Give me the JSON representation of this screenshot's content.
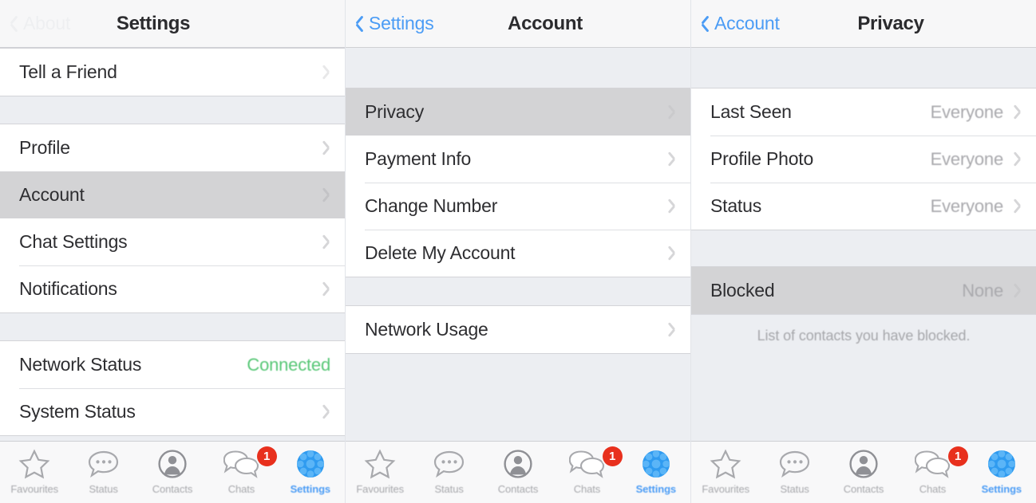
{
  "app": "WhatsApp iOS Settings",
  "colors": {
    "accent_blue": "#4b9cf5",
    "status_green": "#57c776",
    "badge_red": "#e8301d",
    "row_selected": "#d3d3d5",
    "page_background": "#eceef2",
    "row_background": "#ffffff"
  },
  "screens": [
    {
      "id": "settings",
      "nav": {
        "back_label": "About",
        "back_visible_faint": true,
        "title": "Settings"
      },
      "groups": [
        {
          "gap_before": 0,
          "rows": [
            {
              "label": "Tell a Friend",
              "value": "",
              "chevron": true,
              "selected": false
            }
          ]
        },
        {
          "gap_before": 34,
          "rows": [
            {
              "label": "Profile",
              "value": "",
              "chevron": true,
              "selected": false
            },
            {
              "label": "Account",
              "value": "",
              "chevron": true,
              "selected": true
            },
            {
              "label": "Chat Settings",
              "value": "",
              "chevron": true,
              "selected": false
            },
            {
              "label": "Notifications",
              "value": "",
              "chevron": true,
              "selected": false
            }
          ]
        },
        {
          "gap_before": 34,
          "rows": [
            {
              "label": "Network Status",
              "value": "Connected",
              "value_color": "green",
              "chevron": false,
              "selected": false
            },
            {
              "label": "System Status",
              "value": "",
              "chevron": true,
              "selected": false
            }
          ]
        }
      ],
      "footnote": ""
    },
    {
      "id": "account",
      "nav": {
        "back_label": "Settings",
        "back_visible_faint": false,
        "title": "Account"
      },
      "groups": [
        {
          "gap_before": 50,
          "rows": [
            {
              "label": "Privacy",
              "value": "",
              "chevron": true,
              "selected": true
            },
            {
              "label": "Payment Info",
              "value": "",
              "chevron": true,
              "selected": false
            },
            {
              "label": "Change Number",
              "value": "",
              "chevron": true,
              "selected": false
            },
            {
              "label": "Delete My Account",
              "value": "",
              "chevron": true,
              "selected": false
            }
          ]
        },
        {
          "gap_before": 35,
          "rows": [
            {
              "label": "Network Usage",
              "value": "",
              "chevron": true,
              "selected": false
            }
          ]
        }
      ],
      "footnote": ""
    },
    {
      "id": "privacy",
      "nav": {
        "back_label": "Account",
        "back_visible_faint": false,
        "title": "Privacy"
      },
      "groups": [
        {
          "gap_before": 50,
          "rows": [
            {
              "label": "Last Seen",
              "value": "Everyone",
              "chevron": true,
              "selected": false
            },
            {
              "label": "Profile Photo",
              "value": "Everyone",
              "chevron": true,
              "selected": false
            },
            {
              "label": "Status",
              "value": "Everyone",
              "chevron": true,
              "selected": false
            }
          ]
        },
        {
          "gap_before": 45,
          "rows": [
            {
              "label": "Blocked",
              "value": "None",
              "chevron": true,
              "selected": true
            }
          ]
        }
      ],
      "footnote": "List of contacts you have blocked."
    }
  ],
  "tabbar": {
    "tabs": [
      {
        "label": "Favourites",
        "icon": "star-icon",
        "active": false,
        "badge": ""
      },
      {
        "label": "Status",
        "icon": "speech-bubble-icon",
        "active": false,
        "badge": ""
      },
      {
        "label": "Contacts",
        "icon": "person-circle-icon",
        "active": false,
        "badge": ""
      },
      {
        "label": "Chats",
        "icon": "chat-bubbles-icon",
        "active": false,
        "badge": "1"
      },
      {
        "label": "Settings",
        "icon": "gear-icon",
        "active": true,
        "badge": ""
      }
    ]
  }
}
